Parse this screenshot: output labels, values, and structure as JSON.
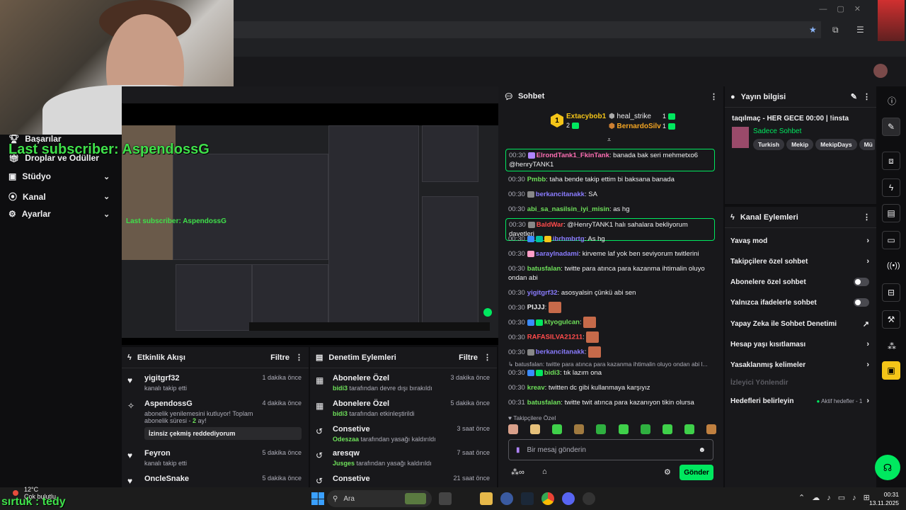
{
  "overlay": {
    "last_subscriber": "Last subscriber: AspendossG",
    "sirtuk": "sırtuk : tedy"
  },
  "nav": {
    "items": [
      {
        "label": "Başarılar",
        "icon": "trophy-icon"
      },
      {
        "label": "Droplar ve Ödüller",
        "icon": "gift-icon"
      },
      {
        "label": "Stüdyo",
        "icon": "video-icon"
      },
      {
        "label": "Kanal",
        "icon": "broadcast-icon"
      },
      {
        "label": "Ayarlar",
        "icon": "gear-icon"
      }
    ]
  },
  "activity": {
    "title": "Etkinlik Akışı",
    "filter": "Filtre",
    "items": [
      {
        "user": "yigitgrf32",
        "desc": "kanalı takip etti",
        "time": "1 dakika önce"
      },
      {
        "user": "AspendossG",
        "desc": "abonelik yenilemesini kutluyor! Toplam abonelik süresi - ",
        "months": "2",
        "desc_end": "ay!",
        "time": "4 dakika önce",
        "button": "İzinsiz çekmiş reddediyorum"
      },
      {
        "user": "Feyron",
        "desc": "kanalı takip etti",
        "time": "5 dakika önce"
      },
      {
        "user": "OncleSnake",
        "desc": "",
        "time": "5 dakika önce"
      }
    ]
  },
  "moderation": {
    "title": "Denetim Eylemleri",
    "filter": "Filtre",
    "items": [
      {
        "title": "Abonelere Özel",
        "user": "bidi3",
        "desc": "tarafından devre dışı bırakıldı",
        "time": "3 dakika önce"
      },
      {
        "title": "Abonelere Özel",
        "user": "bidi3",
        "desc": "tarafından etkinleştirildi",
        "time": "5 dakika önce"
      },
      {
        "title": "Consetive",
        "user": "Odeszaa",
        "desc": "tarafından yasağı kaldırıldı",
        "time": "3 saat önce"
      },
      {
        "title": "aresqw",
        "user": "Jusges",
        "desc": "tarafından yasağı kaldırıldı",
        "time": "7 saat önce"
      },
      {
        "title": "Consetive",
        "user": "",
        "desc": "",
        "time": "21 saat önce"
      }
    ]
  },
  "chat": {
    "title": "Sohbet",
    "leaderboard": {
      "first": "Extacybob1",
      "first_count": "2",
      "rank": "1",
      "second": "heal_strike",
      "second_count": "1",
      "third": "BernardoSilv",
      "third_count": "1"
    },
    "messages": [
      {
        "ts": "00:30",
        "user": "ElrondTank1_FkinTank",
        "color": "#ff6eb4",
        "text": ": banada bak seri mehmetxo6 @henryTANK1",
        "hl": true
      },
      {
        "ts": "00:30",
        "user": "Pmbb",
        "color": "#6ee05a",
        "text": ": taha bende takip ettim bi baksana banada"
      },
      {
        "ts": "00:30",
        "user": "berkancitanakk",
        "color": "#8a7cff",
        "text": ": SA"
      },
      {
        "ts": "00:30",
        "user": "abi_sa_nasilsin_iyi_misin",
        "color": "#6ee05a",
        "text": ": as hg"
      },
      {
        "ts": "00:30",
        "user": "BaldWar",
        "color": "#ff4b4b",
        "text": ": @HenryTANK1 halı sahalara bekliyorum davetleri",
        "hl": true
      },
      {
        "ts": "00:30",
        "user": "ibrhmbrtg",
        "color": "#8a7cff",
        "text": ": As hg"
      },
      {
        "ts": "00:30",
        "user": "saraylnadami",
        "color": "#8a7cff",
        "text": ": kirveme laf yok ben seviyorum twitlerini"
      },
      {
        "ts": "00:30",
        "user": "batusfalan",
        "color": "#6ee05a",
        "text": ": twitte para atınca para kazanma ihtimalin oluyo ondan abi"
      },
      {
        "ts": "00:30",
        "user": "yigitgrf32",
        "color": "#8a7cff",
        "text": ": asosyalsin çünkü abi sen"
      },
      {
        "ts": "00:30",
        "user": "PIJJJ",
        "color": "#efeff1",
        "text": ":"
      },
      {
        "ts": "00:30",
        "user": "ktyogulcan",
        "color": "#6ee05a",
        "text": ":"
      },
      {
        "ts": "00:30",
        "user": "RAFASILVA21211",
        "color": "#ff4b4b",
        "text": ":"
      },
      {
        "ts": "00:30",
        "user": "berkancitanakk",
        "color": "#8a7cff",
        "text": ":"
      },
      {
        "ts": "",
        "user": "",
        "color": "#adadb8",
        "text": "batusfalan: twitte para atınca para kazanma ihtimalin oluyo ondan abi l..."
      },
      {
        "ts": "00:30",
        "user": "bidi3",
        "color": "#6ee05a",
        "text": ": tık lazım ona"
      },
      {
        "ts": "00:30",
        "user": "kreav",
        "color": "#6ee05a",
        "text": ": twitten dc gibi kullanmaya karşıyız"
      },
      {
        "ts": "00:31",
        "user": "batusfalan",
        "color": "#6ee05a",
        "text": ": twitte twit atınca para kazanıyon tikin olursa"
      }
    ],
    "followers_only": "Takipçilere Özel",
    "input_placeholder": "Bir mesaj gönderin",
    "send": "Gönder"
  },
  "stream_info": {
    "title": "Yayın bilgisi",
    "stream_title": "taqılmaç - HER GECE 00:00 | !insta",
    "category": "Sadece Sohbet",
    "tags": [
      "Turkish",
      "Mekip",
      "MekipDays",
      "Mü"
    ]
  },
  "channel_actions": {
    "title": "Kanal Eylemleri",
    "items": [
      {
        "label": "Yavaş mod",
        "kind": "chevron"
      },
      {
        "label": "Takipçilere özel sohbet",
        "kind": "chevron"
      },
      {
        "label": "Abonelere özel sohbet",
        "kind": "toggle"
      },
      {
        "label": "Yalnızca ifadelerle sohbet",
        "kind": "toggle"
      },
      {
        "label": "Yapay Zeka ile Sohbet Denetimi",
        "kind": "external"
      },
      {
        "label": "Hesap yaşı kısıtlaması",
        "kind": "chevron"
      },
      {
        "label": "Yasaklanmış kelimeler",
        "kind": "chevron"
      },
      {
        "label": "İzleyici Yönlendir",
        "kind": "disabled"
      },
      {
        "label": "Hedefleri belirleyin",
        "kind": "goal",
        "extra": "Aktif hedefler - 1"
      }
    ]
  },
  "taskbar": {
    "search": "Ara",
    "weather_temp": "12°C",
    "weather_desc": "Çok bulutlu",
    "time": "00:31",
    "date": "13.11.2025"
  },
  "colors": {
    "accent": "#00e85f",
    "bg": "#0e0e10",
    "panel": "#18181b",
    "overlay_green": "#3fe04a"
  }
}
